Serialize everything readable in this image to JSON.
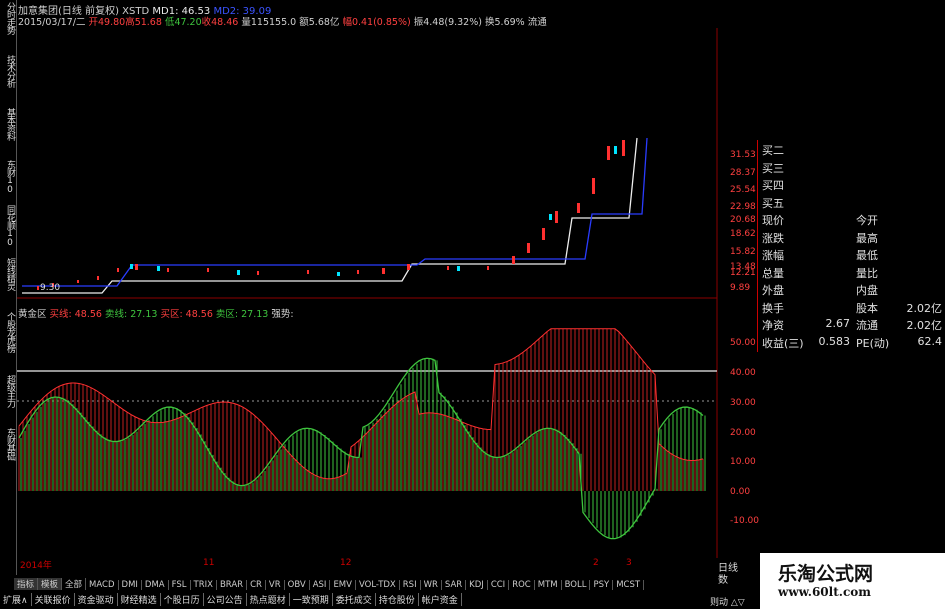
{
  "left_tabs": [
    "分时走势",
    "技术分析",
    "基本资料",
    "东财10",
    "同花顺10",
    "短线精灵",
    "个股龙虎榜",
    "超级主力",
    "东财基础"
  ],
  "header": {
    "stock": "加意集团(日线 前复权)",
    "xstd": "XSTD",
    "md1": "MD1: 46.53",
    "md2": "MD2: 39.09"
  },
  "quote": {
    "date": "2015/03/17/二",
    "open_label": "开49.80",
    "high_label": "高51.68",
    "low_label": "低47.20",
    "close_label": "收48.46",
    "volume_label": "量115155.0",
    "amount_label": "额5.68亿",
    "change_label": "幅0.41(0.85%)",
    "amplitude_label": "振4.48(9.32%)",
    "turnover_label": "换5.69% 流通"
  },
  "price_axis": [
    "31.53",
    "28.37",
    "25.54",
    "22.98",
    "20.68",
    "18.62",
    "15.82",
    "13.48",
    "12.21",
    "9.89"
  ],
  "min_price_label": "9.30",
  "indicator": {
    "name": "黄金区",
    "buy_line": "买线: 48.56",
    "sell_line": "卖线: 27.13",
    "buy_zone": "买区: 48.56",
    "sell_zone": "卖区: 27.13",
    "strength": "强势:"
  },
  "indicator_axis": [
    "50.00",
    "40.00",
    "30.00",
    "20.00",
    "10.00",
    "0.00",
    "-10.00"
  ],
  "time_axis": [
    "2014年",
    "11",
    "12",
    "2",
    "3"
  ],
  "right_panel": [
    {
      "a": "买二"
    },
    {
      "a": "买三"
    },
    {
      "a": "买四"
    },
    {
      "a": "买五"
    },
    {
      "a": "现价",
      "b": "今开"
    },
    {
      "a": "涨跌",
      "b": "最高"
    },
    {
      "a": "涨幅",
      "b": "最低"
    },
    {
      "a": "总量",
      "b": "量比"
    },
    {
      "a": "外盘",
      "b": "内盘"
    },
    {
      "a": "换手",
      "b": "股本",
      "v": "2.02亿"
    },
    {
      "a": "净资",
      "n": "2.67",
      "b": "流通",
      "v": "2.02亿"
    },
    {
      "a": "收益(三)",
      "n": "0.583",
      "b": "PE(动)",
      "v": "62.4"
    }
  ],
  "toolbar_tabs": [
    "指标",
    "模板",
    "全部",
    "MACD",
    "DMI",
    "DMA",
    "FSL",
    "TRIX",
    "BRAR",
    "CR",
    "VR",
    "OBV",
    "ASI",
    "EMV",
    "VOL-TDX",
    "RSI",
    "WR",
    "SAR",
    "KDJ",
    "CCI",
    "ROC",
    "MTM",
    "BOLL",
    "PSY",
    "MCST"
  ],
  "bottom_tabs": [
    "扩展∧",
    "关联报价",
    "资金驱动",
    "财经精选",
    "个股日历",
    "公司公告",
    "热点题材",
    "一致预期",
    "委托成交",
    "持仓股份",
    "帐户资金"
  ],
  "corner_tabs": [
    "日线",
    "数"
  ],
  "corner_bottom": "则动 △▽",
  "brand": {
    "name": "乐淘公式网",
    "url": "www.60lt.com"
  },
  "colors": {
    "up": "#ff3030",
    "down": "#00e5ff",
    "green": "#3ec43e",
    "white_line": "#eeeeee",
    "blue_line": "#2a3cff"
  }
}
